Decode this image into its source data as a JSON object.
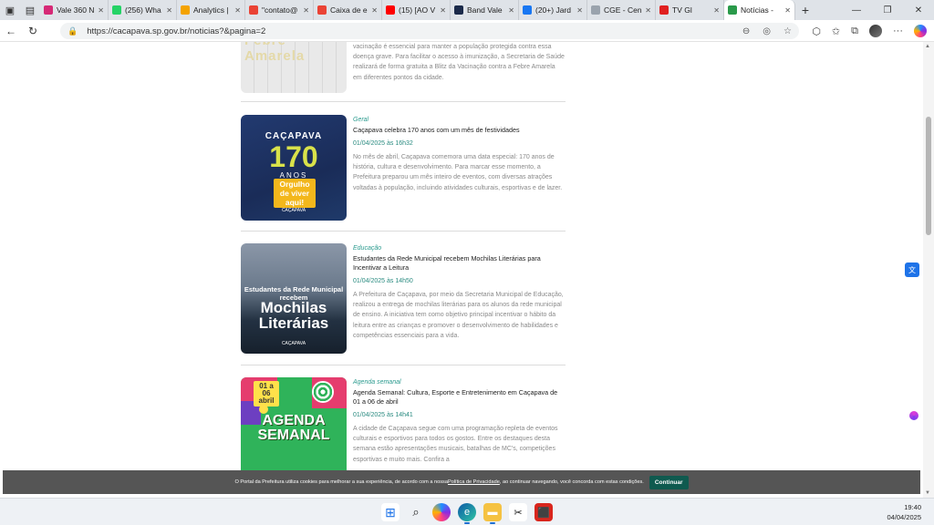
{
  "browser": {
    "tabs": [
      {
        "label": "Vale 360 N",
        "icon": "instagram-icon",
        "color": "#d62976"
      },
      {
        "label": "(256) Wha",
        "icon": "whatsapp-icon",
        "color": "#25d366"
      },
      {
        "label": "Analytics |",
        "icon": "analytics-icon",
        "color": "#f4a300"
      },
      {
        "label": "\"contato@",
        "icon": "gmail-icon",
        "color": "#ea4335"
      },
      {
        "label": "Caixa de e",
        "icon": "gmail-icon",
        "color": "#ea4335"
      },
      {
        "label": "(15) [AO V",
        "icon": "youtube-icon",
        "color": "#ff0000"
      },
      {
        "label": "Band Vale",
        "icon": "band-icon",
        "color": "#1b2a4a"
      },
      {
        "label": "(20+) Jard",
        "icon": "facebook-icon",
        "color": "#1877f2"
      },
      {
        "label": "CGE - Cen",
        "icon": "cge-icon",
        "color": "#9aa3ad"
      },
      {
        "label": "TV Gl",
        "icon": "tv-globo-icon",
        "color": "#e02020"
      },
      {
        "label": "Notícias -",
        "icon": "cacapava-icon",
        "color": "#2a9a4a",
        "active": true
      }
    ],
    "url": "https://cacapava.sp.gov.br/noticias?&pagina=2"
  },
  "news": [
    {
      "thumb_text": "Febre Amarela",
      "category": "",
      "title": "",
      "date": "",
      "description": "vacinação é essencial para manter a população protegida contra essa doença grave. Para facilitar o acesso à imunização, a Secretaria de Saúde realizará de forma gratuita a Blitz da Vacinação contra a Febre Amarela em diferentes pontos da cidade."
    },
    {
      "thumb_city": "CAÇAPAVA",
      "thumb_number": "170",
      "thumb_anos": "ANOS",
      "thumb_badge": "Orgulho de viver aqui!",
      "thumb_logo": "CAÇAPAVA",
      "category": "Geral",
      "title": "Caçapava celebra 170 anos com um mês de festividades",
      "date": "01/04/2025 às 16h32",
      "description": "No mês de abril, Caçapava comemora uma data especial: 170 anos de história, cultura e desenvolvimento. Para marcar esse momento, a Prefeitura preparou um mês inteiro de eventos, com diversas atrações voltadas à população, incluindo atividades culturais, esportivas e de lazer."
    },
    {
      "thumb_line1": "Estudantes da Rede Municipal recebem",
      "thumb_big": "Mochilas Literárias",
      "thumb_logo": "CAÇAPAVA",
      "category": "Educação",
      "title": "Estudantes da Rede Municipal recebem Mochilas Literárias para Incentivar a Leitura",
      "date": "01/04/2025 às 14h50",
      "description": "A Prefeitura de Caçapava, por meio da Secretaria Municipal de Educação, realizou a entrega de mochilas literárias para os alunos da rede municipal de ensino. A iniciativa tem como objetivo principal incentivar o hábito da leitura entre as crianças e promover o desenvolvimento de habilidades e competências essenciais para a vida."
    },
    {
      "thumb_dates": "01 a 06 abril",
      "thumb_big": "AGENDA SEMANAL",
      "category": "Agenda semanal",
      "title": "Agenda Semanal: Cultura, Esporte e Entretenimento em Caçapava de 01 a 06 de abril",
      "date": "01/04/2025 às 14h41",
      "description": "A cidade de Caçapava segue com uma programação repleta de eventos culturais e esportivos para todos os gostos. Entre os destaques desta semana estão apresentações musicais, batalhas de MC's, competições esportivas e muito mais. Confira a"
    }
  ],
  "cookie": {
    "text_before": "O Portal da Prefeitura utiliza cookies para melhorar a sua experiência, de acordo com a nossa ",
    "link": "Política de Privacidade",
    "text_after": ", ao continuar navegando, você concorda com estas condições.",
    "button": "Continuar"
  },
  "taskbar": {
    "time": "19:40",
    "date": "04/04/2025"
  }
}
